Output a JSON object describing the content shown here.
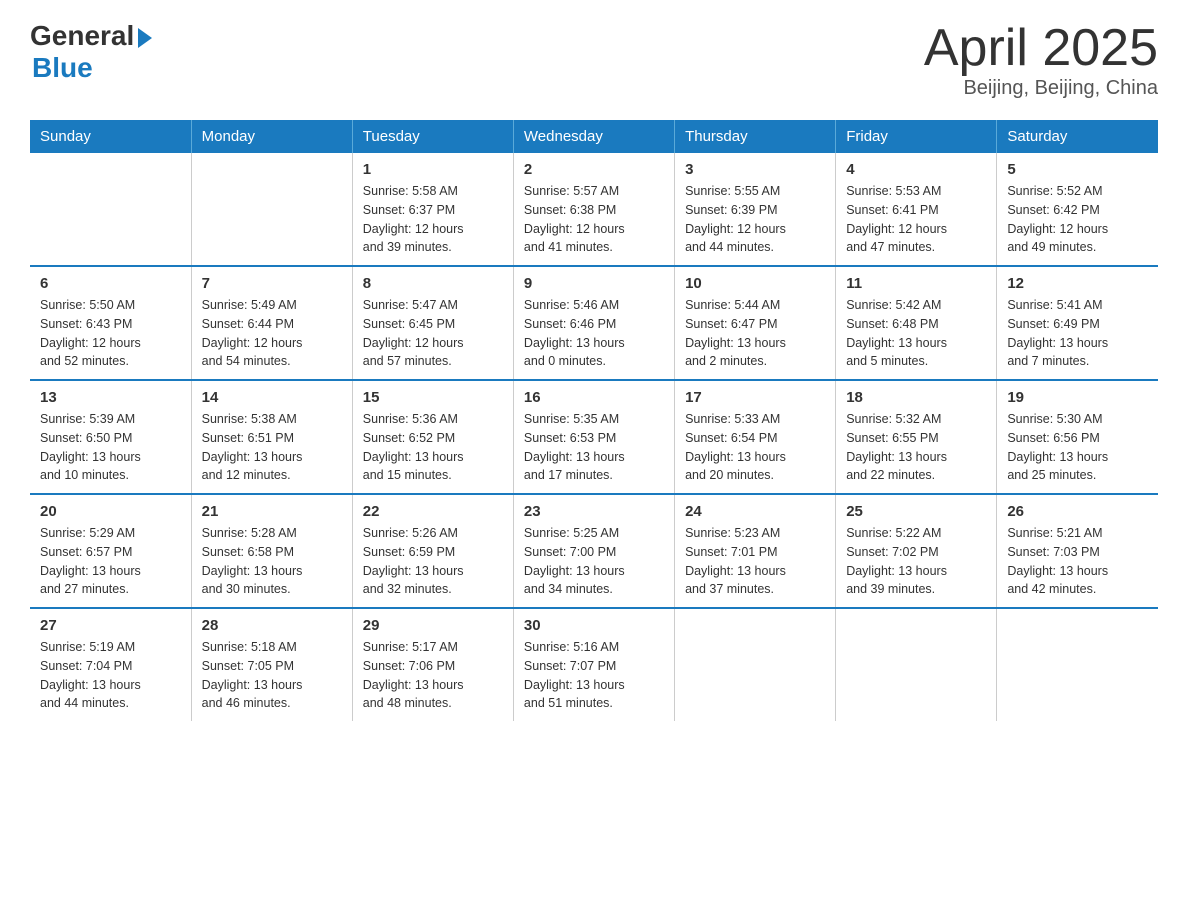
{
  "header": {
    "logo_general": "General",
    "logo_blue": "Blue",
    "title": "April 2025",
    "subtitle": "Beijing, Beijing, China"
  },
  "days_of_week": [
    "Sunday",
    "Monday",
    "Tuesday",
    "Wednesday",
    "Thursday",
    "Friday",
    "Saturday"
  ],
  "weeks": [
    [
      {
        "day": "",
        "info": ""
      },
      {
        "day": "",
        "info": ""
      },
      {
        "day": "1",
        "info": "Sunrise: 5:58 AM\nSunset: 6:37 PM\nDaylight: 12 hours\nand 39 minutes."
      },
      {
        "day": "2",
        "info": "Sunrise: 5:57 AM\nSunset: 6:38 PM\nDaylight: 12 hours\nand 41 minutes."
      },
      {
        "day": "3",
        "info": "Sunrise: 5:55 AM\nSunset: 6:39 PM\nDaylight: 12 hours\nand 44 minutes."
      },
      {
        "day": "4",
        "info": "Sunrise: 5:53 AM\nSunset: 6:41 PM\nDaylight: 12 hours\nand 47 minutes."
      },
      {
        "day": "5",
        "info": "Sunrise: 5:52 AM\nSunset: 6:42 PM\nDaylight: 12 hours\nand 49 minutes."
      }
    ],
    [
      {
        "day": "6",
        "info": "Sunrise: 5:50 AM\nSunset: 6:43 PM\nDaylight: 12 hours\nand 52 minutes."
      },
      {
        "day": "7",
        "info": "Sunrise: 5:49 AM\nSunset: 6:44 PM\nDaylight: 12 hours\nand 54 minutes."
      },
      {
        "day": "8",
        "info": "Sunrise: 5:47 AM\nSunset: 6:45 PM\nDaylight: 12 hours\nand 57 minutes."
      },
      {
        "day": "9",
        "info": "Sunrise: 5:46 AM\nSunset: 6:46 PM\nDaylight: 13 hours\nand 0 minutes."
      },
      {
        "day": "10",
        "info": "Sunrise: 5:44 AM\nSunset: 6:47 PM\nDaylight: 13 hours\nand 2 minutes."
      },
      {
        "day": "11",
        "info": "Sunrise: 5:42 AM\nSunset: 6:48 PM\nDaylight: 13 hours\nand 5 minutes."
      },
      {
        "day": "12",
        "info": "Sunrise: 5:41 AM\nSunset: 6:49 PM\nDaylight: 13 hours\nand 7 minutes."
      }
    ],
    [
      {
        "day": "13",
        "info": "Sunrise: 5:39 AM\nSunset: 6:50 PM\nDaylight: 13 hours\nand 10 minutes."
      },
      {
        "day": "14",
        "info": "Sunrise: 5:38 AM\nSunset: 6:51 PM\nDaylight: 13 hours\nand 12 minutes."
      },
      {
        "day": "15",
        "info": "Sunrise: 5:36 AM\nSunset: 6:52 PM\nDaylight: 13 hours\nand 15 minutes."
      },
      {
        "day": "16",
        "info": "Sunrise: 5:35 AM\nSunset: 6:53 PM\nDaylight: 13 hours\nand 17 minutes."
      },
      {
        "day": "17",
        "info": "Sunrise: 5:33 AM\nSunset: 6:54 PM\nDaylight: 13 hours\nand 20 minutes."
      },
      {
        "day": "18",
        "info": "Sunrise: 5:32 AM\nSunset: 6:55 PM\nDaylight: 13 hours\nand 22 minutes."
      },
      {
        "day": "19",
        "info": "Sunrise: 5:30 AM\nSunset: 6:56 PM\nDaylight: 13 hours\nand 25 minutes."
      }
    ],
    [
      {
        "day": "20",
        "info": "Sunrise: 5:29 AM\nSunset: 6:57 PM\nDaylight: 13 hours\nand 27 minutes."
      },
      {
        "day": "21",
        "info": "Sunrise: 5:28 AM\nSunset: 6:58 PM\nDaylight: 13 hours\nand 30 minutes."
      },
      {
        "day": "22",
        "info": "Sunrise: 5:26 AM\nSunset: 6:59 PM\nDaylight: 13 hours\nand 32 minutes."
      },
      {
        "day": "23",
        "info": "Sunrise: 5:25 AM\nSunset: 7:00 PM\nDaylight: 13 hours\nand 34 minutes."
      },
      {
        "day": "24",
        "info": "Sunrise: 5:23 AM\nSunset: 7:01 PM\nDaylight: 13 hours\nand 37 minutes."
      },
      {
        "day": "25",
        "info": "Sunrise: 5:22 AM\nSunset: 7:02 PM\nDaylight: 13 hours\nand 39 minutes."
      },
      {
        "day": "26",
        "info": "Sunrise: 5:21 AM\nSunset: 7:03 PM\nDaylight: 13 hours\nand 42 minutes."
      }
    ],
    [
      {
        "day": "27",
        "info": "Sunrise: 5:19 AM\nSunset: 7:04 PM\nDaylight: 13 hours\nand 44 minutes."
      },
      {
        "day": "28",
        "info": "Sunrise: 5:18 AM\nSunset: 7:05 PM\nDaylight: 13 hours\nand 46 minutes."
      },
      {
        "day": "29",
        "info": "Sunrise: 5:17 AM\nSunset: 7:06 PM\nDaylight: 13 hours\nand 48 minutes."
      },
      {
        "day": "30",
        "info": "Sunrise: 5:16 AM\nSunset: 7:07 PM\nDaylight: 13 hours\nand 51 minutes."
      },
      {
        "day": "",
        "info": ""
      },
      {
        "day": "",
        "info": ""
      },
      {
        "day": "",
        "info": ""
      }
    ]
  ]
}
